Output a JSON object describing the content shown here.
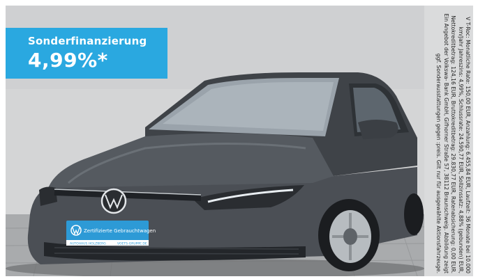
{
  "promo": {
    "label": "Sonderfinanzierung",
    "rate": "4,99%*"
  },
  "plate": {
    "title": "Zertifizierte Gebrauchtwagen",
    "dealer_left": "AUTOHAUS HOLZBERG",
    "dealer_right": "VOETS-GRUPPE.DE"
  },
  "disclaimer": {
    "text": "V T-Roc: Monatliche Rate: 150,00 EUR, Anzahlung: 6.455,84 EUR, Laufzeit: 36 Monate bei 10.000 km/Jahr Jahreszins: 4,99%, Schlussrate: 24.590,77 EUR, Sollzinssatz: 4,88% (gebunden) EUR, Nettokreditbetrag: 124,16 EUR, Bruttokreditbetrag: 29.830,77 EUR, Ratenabsicherung: 0,00 EUR. Ein Angebot der Volkswa- Bank GmbH, Gifhorner Straße 57, 38112 Braunschweig. Abbildung zeigt ggf. Sonderausstattungen gegen :preis. Gilt nur für ausgewählte Aktionsfahrzeuge."
  },
  "colors": {
    "badge_blue": "#2aa8e0",
    "car_body": "#4b4f55",
    "plate_blue": "#2d9ad6",
    "disclaimer_bg": "#dadbdc"
  }
}
